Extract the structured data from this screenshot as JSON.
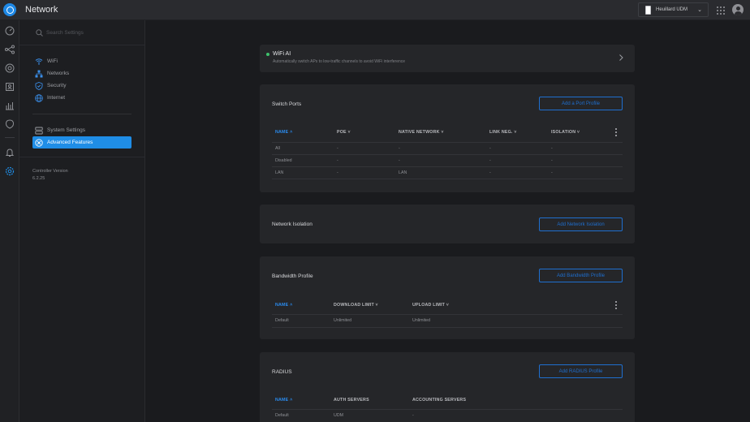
{
  "app": {
    "title": "Network"
  },
  "header": {
    "device_name": "Heuillard UDM",
    "icons": [
      "unifi-logo-icon",
      "device-icon",
      "chevron-down-icon",
      "apps-grid-icon",
      "user-avatar-icon"
    ]
  },
  "rail": {
    "icons": [
      "dashboard-icon",
      "topology-icon",
      "devices-icon",
      "clients-icon",
      "statistics-icon",
      "insights-icon",
      "notifications-icon",
      "settings-icon"
    ]
  },
  "sidebar": {
    "search_placeholder": "Search Settings",
    "items": [
      {
        "label": "WiFi",
        "icon": "wifi-icon"
      },
      {
        "label": "Networks",
        "icon": "networks-icon"
      },
      {
        "label": "Security",
        "icon": "shield-icon"
      },
      {
        "label": "Internet",
        "icon": "globe-icon"
      },
      {
        "label": "System Settings",
        "icon": "system-settings-icon"
      },
      {
        "label": "Advanced Features",
        "icon": "advanced-features-icon",
        "active": true
      }
    ],
    "controller_version_label": "Controller Version",
    "controller_version": "6.2.25"
  },
  "wifi_ai": {
    "title": "WiFi AI",
    "description": "Automatically switch APs to low-traffic channels to avoid WiFi interference",
    "status_color": "#3ec16c"
  },
  "switch_ports": {
    "title": "Switch Ports",
    "button": "Add a Port Profile",
    "columns": [
      "NAME",
      "POE",
      "NATIVE NETWORK",
      "LINK NEG.",
      "ISOLATION"
    ],
    "rows": [
      [
        "All",
        "-",
        "-",
        "-",
        "-"
      ],
      [
        "Disabled",
        "-",
        "-",
        "-",
        "-"
      ],
      [
        "LAN",
        "-",
        "LAN",
        "-",
        "-"
      ]
    ]
  },
  "network_isolation": {
    "title": "Network Isolation",
    "button": "Add Network Isolation"
  },
  "bandwidth_profile": {
    "title": "Bandwidth Profile",
    "button": "Add Bandwidth Profile",
    "columns": [
      "NAME",
      "DOWNLOAD LIMIT",
      "UPLOAD LIMIT"
    ],
    "rows": [
      [
        "Default",
        "Unlimited",
        "Unlimited"
      ]
    ]
  },
  "radius": {
    "title": "RADIUS",
    "button": "Add RADIUS Profile",
    "columns": [
      "NAME",
      "AUTH SERVERS",
      "ACCOUNTING SERVERS"
    ],
    "rows": [
      [
        "Default",
        "UDM",
        "-"
      ]
    ]
  },
  "colors": {
    "accent": "#1f8de6",
    "background": "#1a1b1e",
    "card": "#252629"
  }
}
